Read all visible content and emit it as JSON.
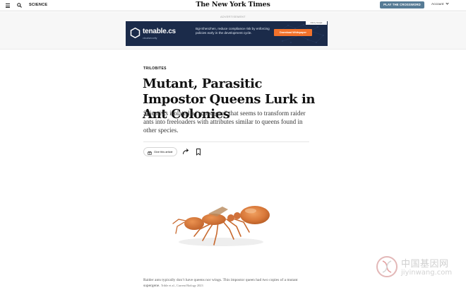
{
  "header": {
    "section": "SCIENCE",
    "logo": "The New York Times",
    "crossword_button": "PLAY THE CROSSWORD",
    "account": "Account"
  },
  "ad": {
    "label": "ADVERTISEMENT",
    "brand": "tenable.cs",
    "brand_sub": "cloudsecurity",
    "copy": "Bgi-Shenzhen, reduce compliance risk by enforcing policies early in the development cycle.",
    "cta": "Download Whitepaper",
    "corner": "Ads by Google",
    "colors": {
      "background": "#1b2b4a",
      "cta": "#f2722b"
    }
  },
  "article": {
    "kicker": "TRILOBITES",
    "headline": "Mutant, Parasitic Impostor Queens Lurk in Ant Colonies",
    "dek": "Scientists isolated a “supergene” that seems to transform raider ants into freeloaders with attributes similar to queens found in other species.",
    "gift_label": "Give this article",
    "caption": "Raider ants typically don’t have queens nor wings. This impostor queen had two copies of a mutant supergene.",
    "credit": "Trible et al., Current Biology 2023"
  },
  "watermark": {
    "cn": "中国基因网",
    "en": "jiyinwang.com"
  },
  "colors": {
    "crossword_button": "#567b95",
    "ant": "#d9793a"
  }
}
